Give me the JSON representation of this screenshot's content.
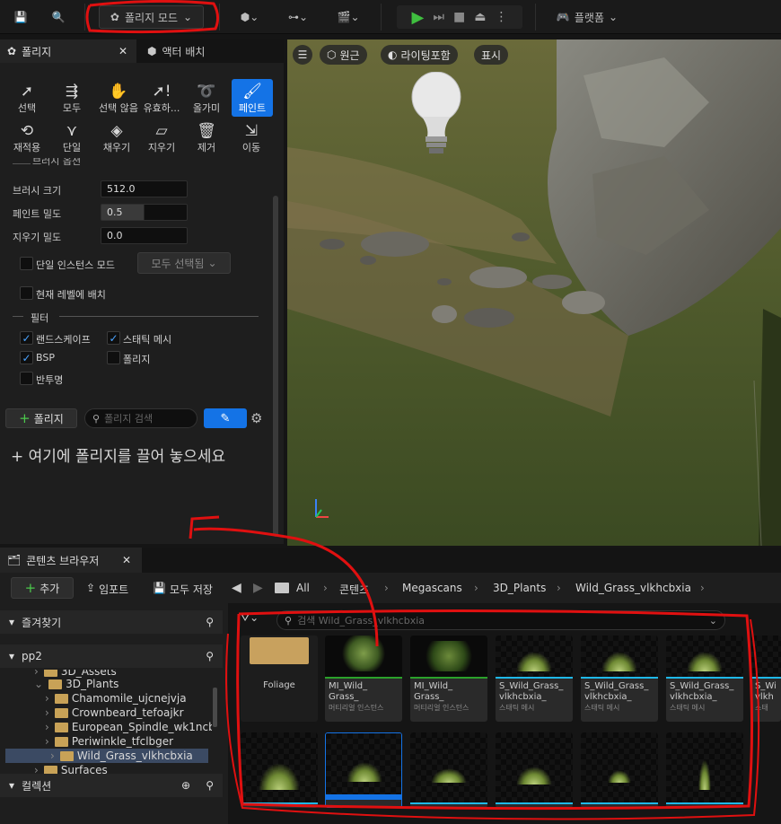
{
  "toolbar": {
    "mode_label": "폴리지 모드",
    "platform_label": "플랫폼"
  },
  "left_panel": {
    "tabs": [
      {
        "label": "폴리지"
      },
      {
        "label": "액터 배치"
      }
    ],
    "tools_row1": [
      {
        "label": "선택",
        "icon": "cursor-icon"
      },
      {
        "label": "모두",
        "icon": "select-all-icon"
      },
      {
        "label": "선택 않음",
        "icon": "deselect-icon"
      },
      {
        "label": "유효하...",
        "icon": "invalid-icon"
      },
      {
        "label": "올가미",
        "icon": "lasso-icon"
      },
      {
        "label": "페인트",
        "icon": "paint-brush-icon"
      }
    ],
    "tools_row2": [
      {
        "label": "재적용",
        "icon": "reapply-icon"
      },
      {
        "label": "단일",
        "icon": "single-icon"
      },
      {
        "label": "채우기",
        "icon": "fill-icon"
      },
      {
        "label": "지우기",
        "icon": "erase-icon"
      },
      {
        "label": "제거",
        "icon": "trash-icon"
      },
      {
        "label": "이동",
        "icon": "move-icon"
      }
    ],
    "section_header": "브러시 옵션",
    "brush_size_label": "브러시 크기",
    "brush_size_value": "512.0",
    "paint_density_label": "페인트 밀도",
    "paint_density_value": "0.5",
    "erase_density_label": "지우기 밀도",
    "erase_density_value": "0.0",
    "single_instance_label": "단일 인스턴스 모드",
    "select_all_dropdown": "모두 선택됨",
    "place_current_level_label": "현재 레벨에 배치",
    "filter_header": "필터",
    "filters": [
      {
        "label": "랜드스케이프",
        "checked": true
      },
      {
        "label": "스태틱 메시",
        "checked": true
      },
      {
        "label": "BSP",
        "checked": true
      },
      {
        "label": "폴리지",
        "checked": false
      },
      {
        "label": "반투명",
        "checked": false
      }
    ],
    "add_foliage_label": "폴리지",
    "search_placeholder": "폴리지 검색",
    "drop_hint": "+ 여기에 폴리지를 끌어 놓으세요"
  },
  "viewport": {
    "perspective_label": "원근",
    "lighting_label": "라이팅포함",
    "show_label": "표시"
  },
  "content_browser": {
    "tab_label": "콘텐츠 브라우저",
    "add_label": "추가",
    "import_label": "임포트",
    "save_all_label": "모두 저장",
    "breadcrumbs": [
      "All",
      "콘텐츠",
      "Megascans",
      "3D_Plants",
      "Wild_Grass_vlkhcbxia"
    ],
    "favorites_label": "즐겨찾기",
    "project_label": "pp2",
    "collections_label": "컬렉션",
    "tree": [
      {
        "label": "3D_Assets"
      },
      {
        "label": "3D_Plants"
      },
      {
        "label": "Chamomile_ujcnejvja"
      },
      {
        "label": "Crownbeard_tefoajkr"
      },
      {
        "label": "European_Spindle_wk1ncb"
      },
      {
        "label": "Periwinkle_tfclbger"
      },
      {
        "label": "Wild_Grass_vlkhcbxia"
      },
      {
        "label": "Surfaces"
      }
    ],
    "search_placeholder": "검색 Wild_Grass_vlkhcbxia",
    "assets_row1": [
      {
        "name": "Foliage",
        "sub": ""
      },
      {
        "name": "MI_Wild_ Grass_",
        "sub": "머티리얼 인스턴스"
      },
      {
        "name": "MI_Wild_ Grass_",
        "sub": "머티리얼 인스턴스"
      },
      {
        "name": "S_Wild_Grass_ vlkhcbxia_",
        "sub": "스태틱 메시"
      },
      {
        "name": "S_Wild_Grass_ vlkhcbxia_",
        "sub": "스태틱 메시"
      },
      {
        "name": "S_Wild_Grass_ vlkhcbxia_",
        "sub": "스태틱 메시"
      },
      {
        "name": "S_Wi vlkh",
        "sub": "스태"
      }
    ]
  },
  "colors": {
    "accent": "#1473e6",
    "annotation": "#e01010",
    "folder": "#c8a257",
    "cyan_bar": "#1fb8e8"
  }
}
